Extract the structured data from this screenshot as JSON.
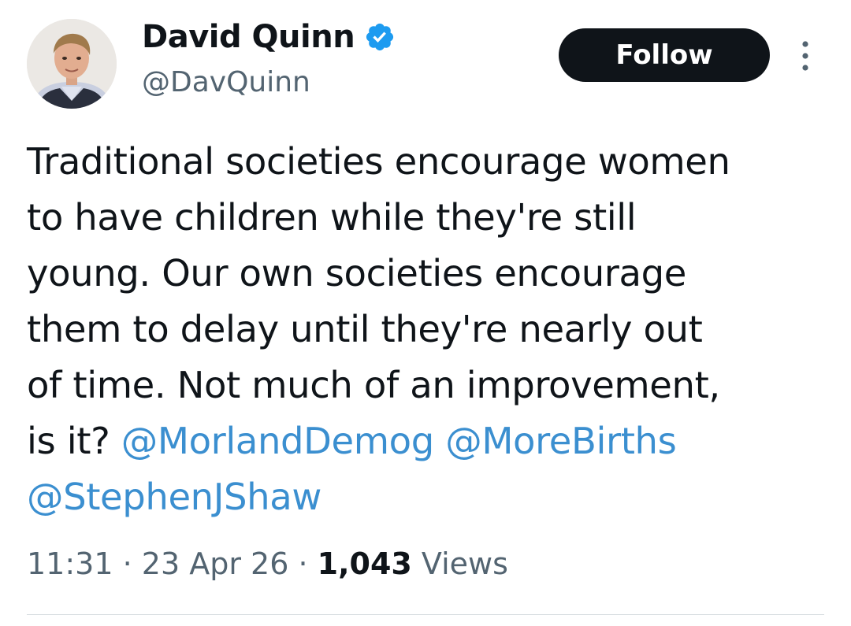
{
  "author": {
    "display_name": "David Quinn",
    "handle": "@DavQuinn",
    "verified": true,
    "verified_color": "#1d9bf0"
  },
  "actions": {
    "follow_label": "Follow",
    "more_icon": "more-vertical-icon"
  },
  "tweet": {
    "text_lines": [
      "Traditional societies encourage women",
      "to have children while they're still",
      "young. Our own societies encourage",
      "them to delay until they're nearly out",
      "of time. Not much of an improvement,"
    ],
    "last_line_prefix": "is it? ",
    "mentions": [
      "@MorlandDemog",
      "@MoreBirths",
      "@StephenJShaw"
    ],
    "mention_color": "#3b8fd0"
  },
  "meta": {
    "time": "11:31",
    "separator": " · ",
    "date": "23 Apr 26",
    "views_count": "1,043",
    "views_label": " Views"
  }
}
